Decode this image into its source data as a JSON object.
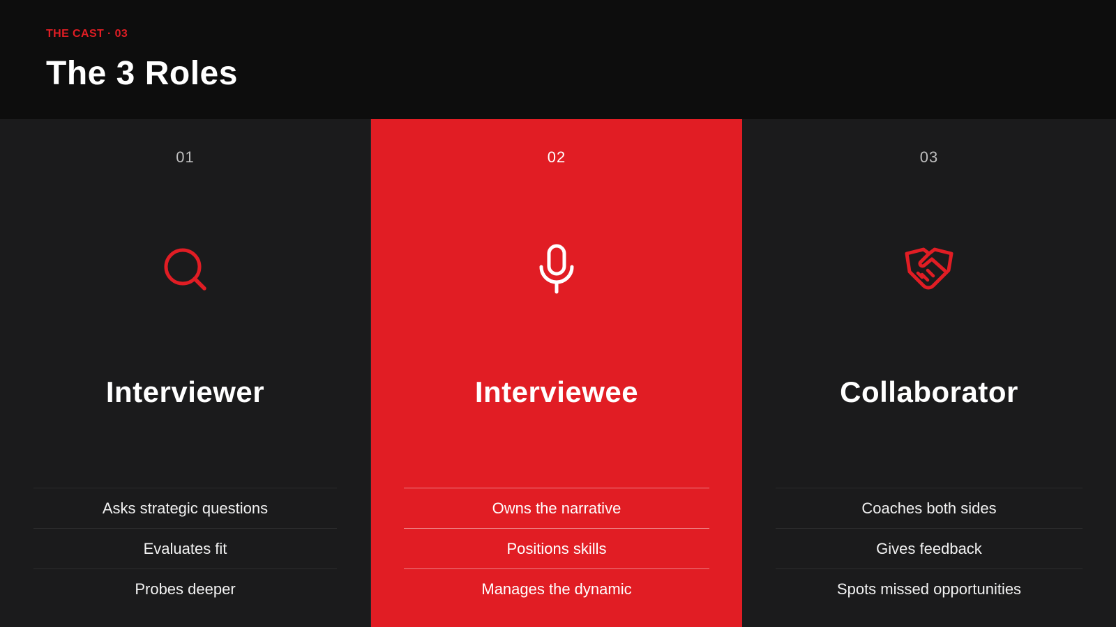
{
  "header": {
    "kicker": "THE CAST · 03",
    "title": "The 3 Roles"
  },
  "colors": {
    "accent": "#e11d24",
    "background": "#0d0d0d",
    "card": "#1b1b1c",
    "text": "#ffffff"
  },
  "cards": [
    {
      "number": "01",
      "icon": "search-icon",
      "title": "Interviewer",
      "highlighted": false,
      "items": [
        "Asks strategic questions",
        "Evaluates fit",
        "Probes deeper"
      ]
    },
    {
      "number": "02",
      "icon": "microphone-icon",
      "title": "Interviewee",
      "highlighted": true,
      "items": [
        "Owns the narrative",
        "Positions skills",
        "Manages the dynamic"
      ]
    },
    {
      "number": "03",
      "icon": "handshake-icon",
      "title": "Collaborator",
      "highlighted": false,
      "items": [
        "Coaches both sides",
        "Gives feedback",
        "Spots missed opportunities"
      ]
    }
  ]
}
